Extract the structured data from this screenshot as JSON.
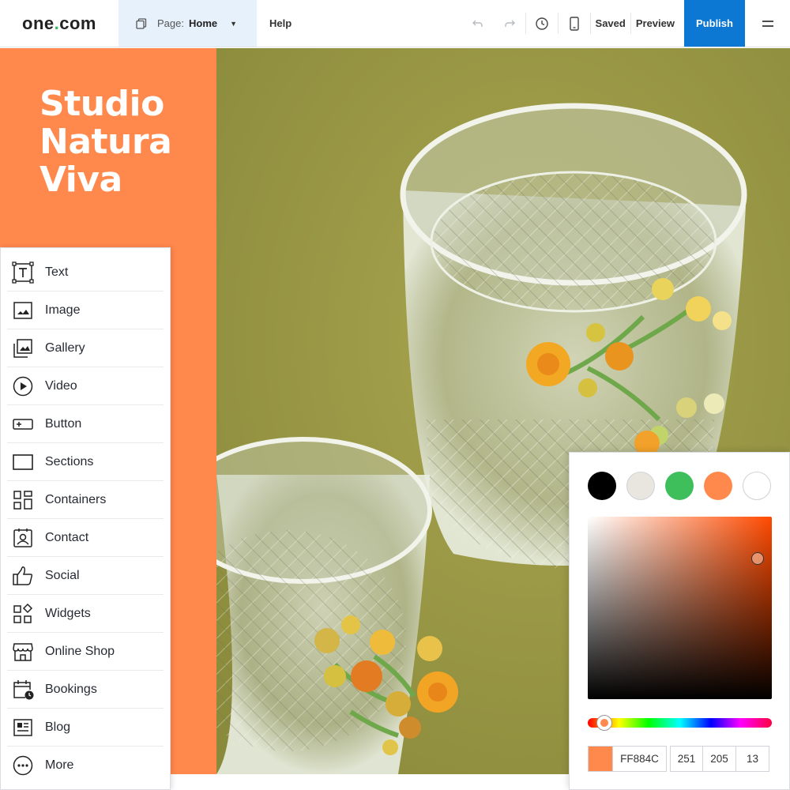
{
  "topbar": {
    "logo_left": "one",
    "logo_dot": ".",
    "logo_right": "com",
    "page_label": "Page:",
    "page_value": "Home",
    "help": "Help",
    "saved": "Saved",
    "preview": "Preview",
    "publish": "Publish",
    "publish_color": "#0d77d4"
  },
  "site": {
    "title_lines": [
      "Studio",
      "Natura",
      "Viva"
    ],
    "panel_color": "#ff884c"
  },
  "components": [
    {
      "label": "Text",
      "icon": "text-icon"
    },
    {
      "label": "Image",
      "icon": "image-icon"
    },
    {
      "label": "Gallery",
      "icon": "gallery-icon"
    },
    {
      "label": "Video",
      "icon": "video-icon"
    },
    {
      "label": "Button",
      "icon": "button-icon"
    },
    {
      "label": "Sections",
      "icon": "sections-icon"
    },
    {
      "label": "Containers",
      "icon": "containers-icon"
    },
    {
      "label": "Contact",
      "icon": "contact-icon"
    },
    {
      "label": "Social",
      "icon": "social-icon"
    },
    {
      "label": "Widgets",
      "icon": "widgets-icon"
    },
    {
      "label": "Online Shop",
      "icon": "shop-icon"
    },
    {
      "label": "Bookings",
      "icon": "bookings-icon"
    },
    {
      "label": "Blog",
      "icon": "blog-icon"
    },
    {
      "label": "More",
      "icon": "more-icon"
    }
  ],
  "color_picker": {
    "swatches": [
      "#000000",
      "#e8e6df",
      "#3fbe5c",
      "#ff884c",
      "#ffffff"
    ],
    "hex": "FF884C",
    "r": "251",
    "g": "205",
    "b": "13"
  }
}
